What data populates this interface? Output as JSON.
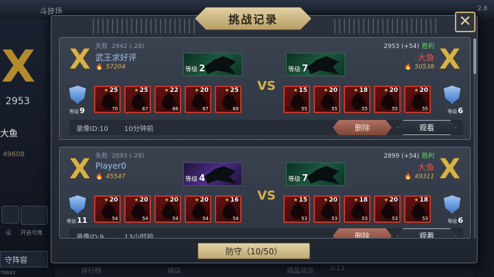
{
  "background": {
    "arena_label": "斗技场",
    "top_right": "2.8",
    "left_score": "2953",
    "left_name": "大鱼",
    "left_power": "49608",
    "left_icon_label_1": "设",
    "left_icon_label_2": "开启号角",
    "team_button": "守阵容",
    "footer_id": "76843",
    "bottom_tabs": [
      "排行榜",
      "商店",
      "商品欢乐",
      "3/13"
    ]
  },
  "modal": {
    "title": "挑战记录",
    "close_icon": "close-x-icon",
    "defense_button": "防守（10/50）"
  },
  "records": [
    {
      "left": {
        "status": "失败",
        "score": "2942 (-28)",
        "name": "武王求好评",
        "power": "57204",
        "dragon_level_label": "等级",
        "dragon_level": "2",
        "dragon_color": "green",
        "shield_level_label": "等级",
        "shield_level": "9",
        "cards": [
          {
            "stars": "25",
            "level": "70"
          },
          {
            "stars": "25",
            "level": "67"
          },
          {
            "stars": "22",
            "level": "66"
          },
          {
            "stars": "20",
            "level": "67"
          },
          {
            "stars": "25",
            "level": "69"
          }
        ]
      },
      "vs": "VS",
      "right": {
        "score": "2953 (+54)",
        "result": "胜利",
        "name": "大鱼",
        "power": "50538",
        "dragon_level_label": "等级",
        "dragon_level": "7",
        "dragon_color": "green",
        "shield_level_label": "等级",
        "shield_level": "6",
        "cards": [
          {
            "stars": "15",
            "level": "55"
          },
          {
            "stars": "20",
            "level": "55"
          },
          {
            "stars": "18",
            "level": "55"
          },
          {
            "stars": "20",
            "level": "55"
          },
          {
            "stars": "20",
            "level": "55"
          }
        ]
      },
      "replay_id": "录像ID:10",
      "time_ago": "10分钟前",
      "delete_label": "删除",
      "watch_label": "观看"
    },
    {
      "left": {
        "status": "失败",
        "score": "2893 (-28)",
        "name": "Player0",
        "power": "45547",
        "dragon_level_label": "等级",
        "dragon_level": "4",
        "dragon_color": "purple",
        "shield_level_label": "等级",
        "shield_level": "11",
        "cards": [
          {
            "stars": "20",
            "level": "54"
          },
          {
            "stars": "20",
            "level": "54"
          },
          {
            "stars": "20",
            "level": "54"
          },
          {
            "stars": "20",
            "level": "54"
          },
          {
            "stars": "16",
            "level": "54"
          }
        ]
      },
      "vs": "VS",
      "right": {
        "score": "2899 (+54)",
        "result": "胜利",
        "name": "大鱼",
        "power": "49311",
        "dragon_level_label": "等级",
        "dragon_level": "7",
        "dragon_color": "green",
        "shield_level_label": "等级",
        "shield_level": "6",
        "cards": [
          {
            "stars": "15",
            "level": "53"
          },
          {
            "stars": "20",
            "level": "53"
          },
          {
            "stars": "18",
            "level": "53"
          },
          {
            "stars": "20",
            "level": "53"
          },
          {
            "stars": "18",
            "level": "53"
          }
        ]
      },
      "replay_id": "录像ID:9",
      "time_ago": "13小时前",
      "delete_label": "删除",
      "watch_label": "观看"
    }
  ]
}
